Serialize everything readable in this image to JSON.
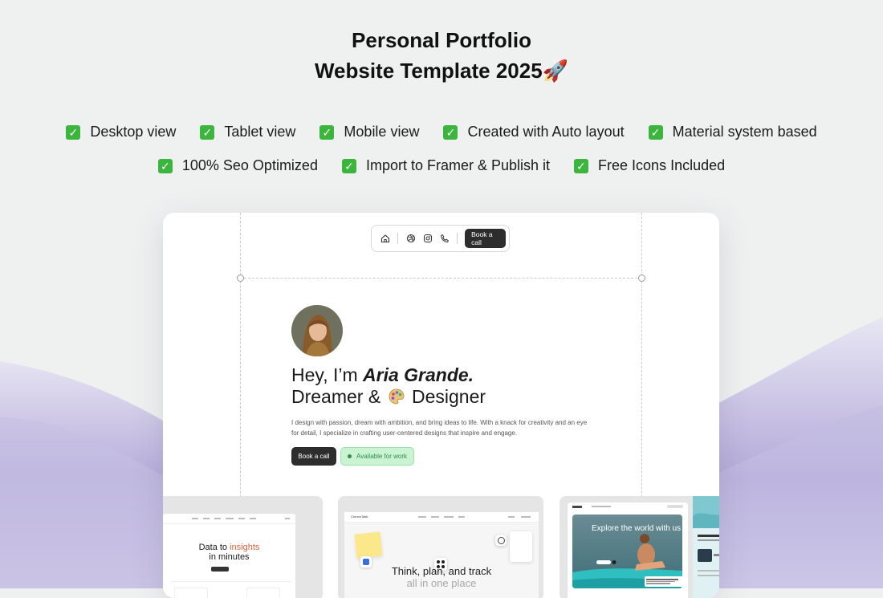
{
  "page": {
    "title_line1": "Personal Portfolio",
    "title_line2": "Website Template 2025🚀",
    "features_row1": [
      "Desktop view",
      "Tablet view",
      "Mobile view",
      "Created with Auto layout",
      "Material system based"
    ],
    "features_row2": [
      "100% Seo Optimized",
      "Import to Framer & Publish it",
      "Free Icons Included"
    ]
  },
  "mockup": {
    "nav": {
      "icons": [
        "home-icon",
        "dribbble-icon",
        "instagram-icon",
        "phone-icon"
      ],
      "cta_label": "Book a call"
    },
    "hero": {
      "greeting": "Hey, I’m ",
      "name": "Aria Grande.",
      "tagline_start": "Dreamer &",
      "tagline_end": "Designer",
      "bio": "I design with passion, dream with ambition, and bring ideas to life. With a knack for creativity and an eye for detail, I specialize in crafting user-centered designs that inspire and engage.",
      "book_call_label": "Book a call",
      "availability_label": "Available for work"
    },
    "projects": [
      {
        "heading_start": "Data to ",
        "heading_accent": "insights",
        "heading_end": "in minutes"
      },
      {
        "brand": "ChronoTask",
        "heading_line1": "Think, plan, and track",
        "heading_line2": "all in one place"
      },
      {
        "heading": "Explore the world with us"
      }
    ]
  },
  "colors": {
    "background": "#eff1f1",
    "wave": "#b3a9d9",
    "primary_button": "#2d2d2d",
    "available_bg": "#c9f3d2",
    "available_text": "#2f8f4a",
    "accent_orange": "#e8623b"
  }
}
